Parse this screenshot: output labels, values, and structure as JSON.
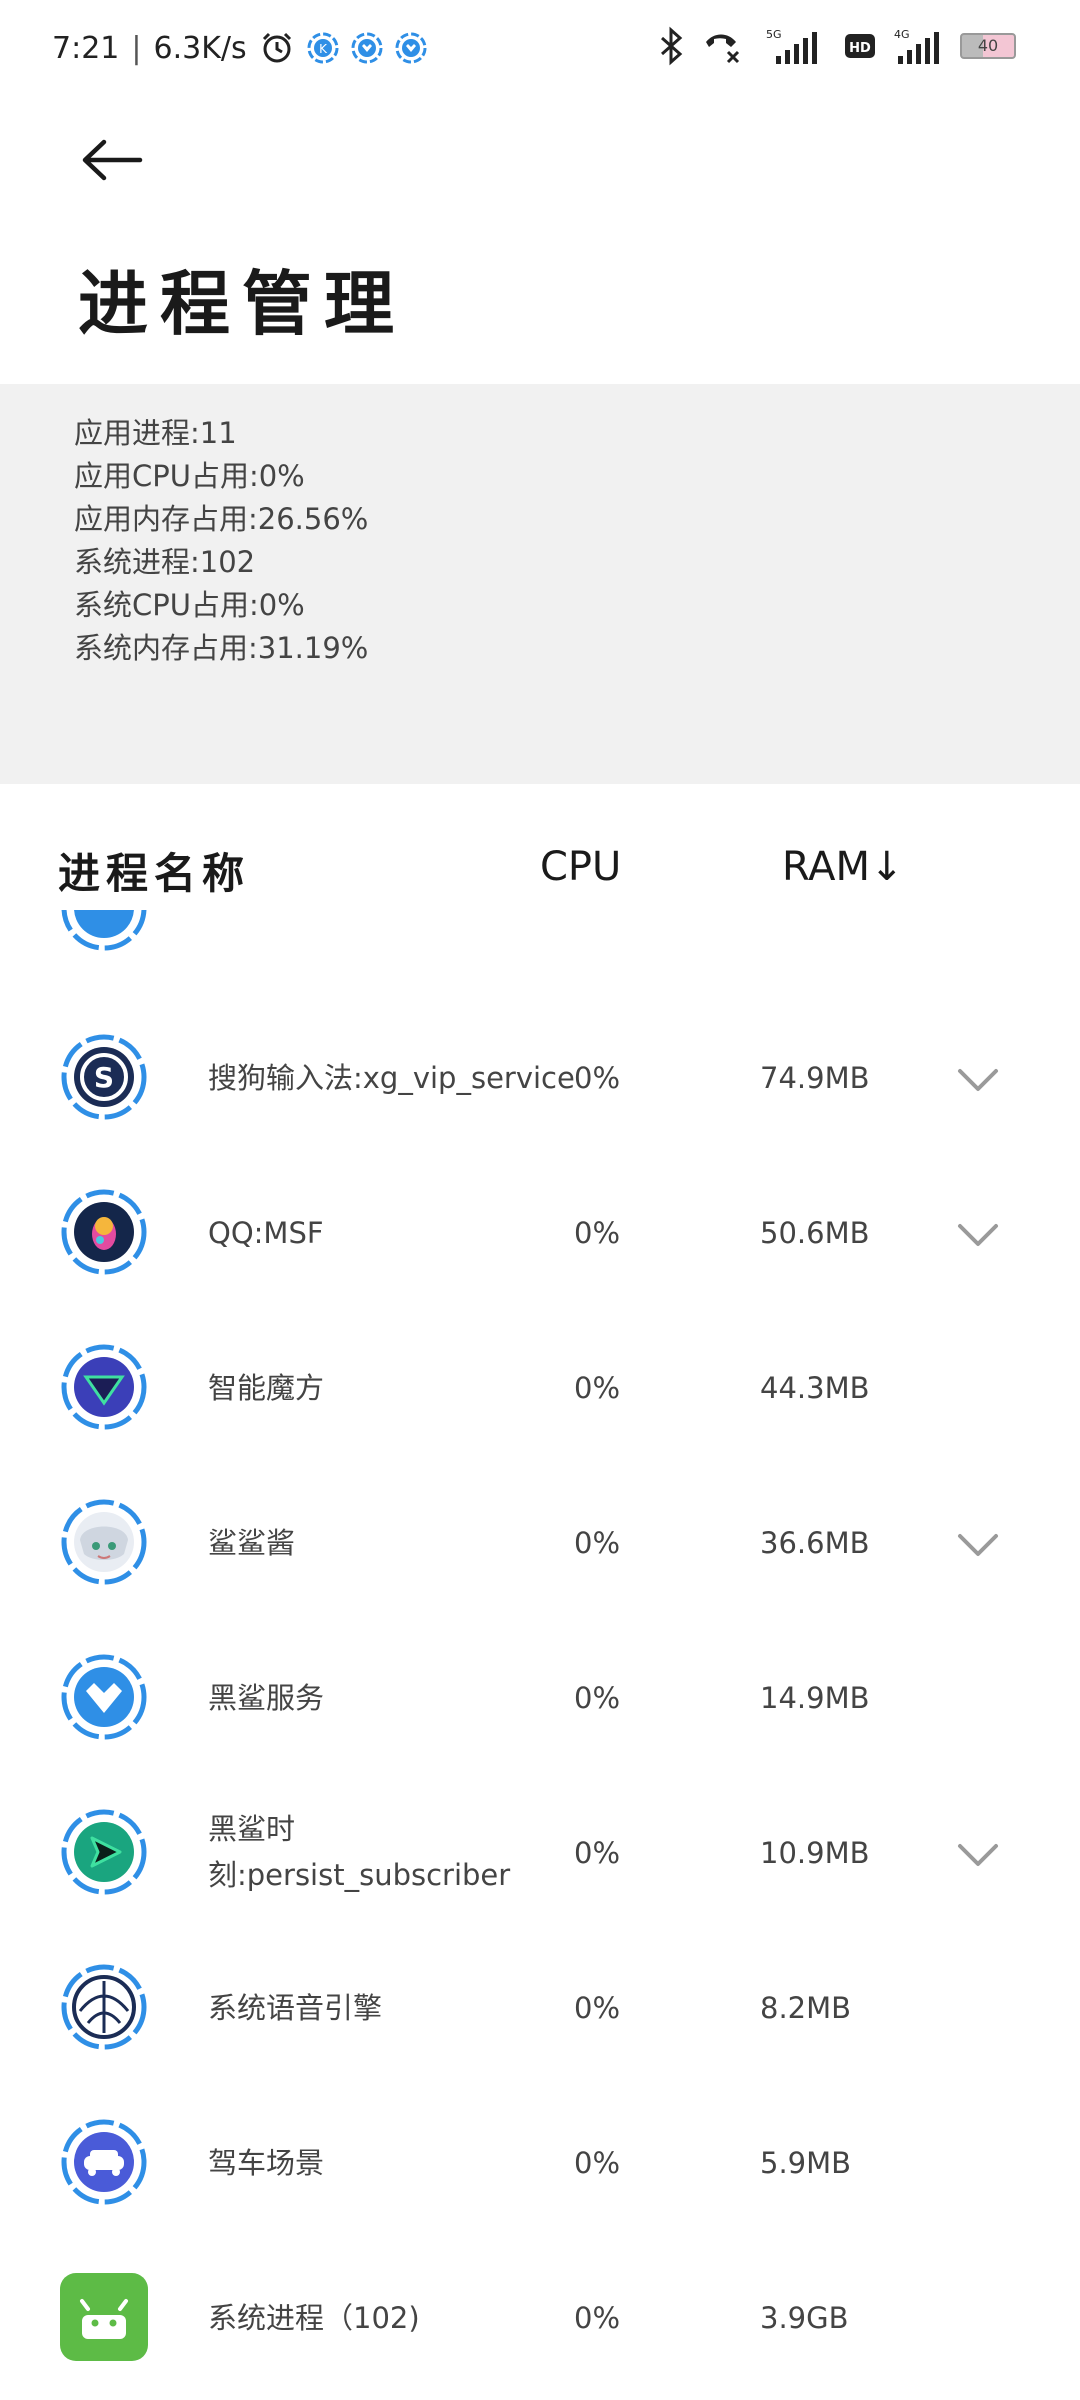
{
  "status_bar": {
    "time": "7:21",
    "separator": "|",
    "net_speed": "6.3K/s",
    "network_5g": "5G",
    "network_4g": "4G",
    "hd_label": "HD",
    "battery": "40"
  },
  "header": {
    "title": "进程管理"
  },
  "summary": {
    "lines": [
      "应用进程:11",
      "应用CPU占用:0%",
      "应用内存占用:26.56%",
      "系统进程:102",
      "系统CPU占用:0%",
      "系统内存占用:31.19%"
    ]
  },
  "table": {
    "col_name": "进程名称",
    "col_cpu": "CPU",
    "col_ram": "RAM↓",
    "rows": [
      {
        "name": "搜狗输入法:xg_vip_service",
        "cpu": "0%",
        "ram": "74.9MB",
        "expandable": true,
        "icon": "sogou-icon"
      },
      {
        "name": "QQ:MSF",
        "cpu": "0%",
        "ram": "50.6MB",
        "expandable": true,
        "icon": "qq-icon"
      },
      {
        "name": "智能魔方",
        "cpu": "0%",
        "ram": "44.3MB",
        "expandable": false,
        "icon": "magic-cube-icon"
      },
      {
        "name": "鲨鲨酱",
        "cpu": "0%",
        "ram": "36.6MB",
        "expandable": true,
        "icon": "shark-icon"
      },
      {
        "name": "黑鲨服务",
        "cpu": "0%",
        "ram": "14.9MB",
        "expandable": false,
        "icon": "blackshark-service-icon"
      },
      {
        "name_line1": "黑鲨时",
        "name_line2": "刻:persist_subscriber",
        "cpu": "0%",
        "ram": "10.9MB",
        "expandable": true,
        "icon": "blackshark-moment-icon"
      },
      {
        "name": "系统语音引擎",
        "cpu": "0%",
        "ram": "8.2MB",
        "expandable": false,
        "icon": "voice-engine-icon"
      },
      {
        "name": "驾车场景",
        "cpu": "0%",
        "ram": "5.9MB",
        "expandable": false,
        "icon": "driving-icon"
      },
      {
        "name": "系统进程（102)",
        "cpu": "0%",
        "ram": "3.9GB",
        "expandable": false,
        "icon": "android-icon"
      }
    ]
  },
  "colors": {
    "summary_bg": "#f1f1f1",
    "ring_blue": "#2f8fe6",
    "android_green": "#5dbb46"
  }
}
